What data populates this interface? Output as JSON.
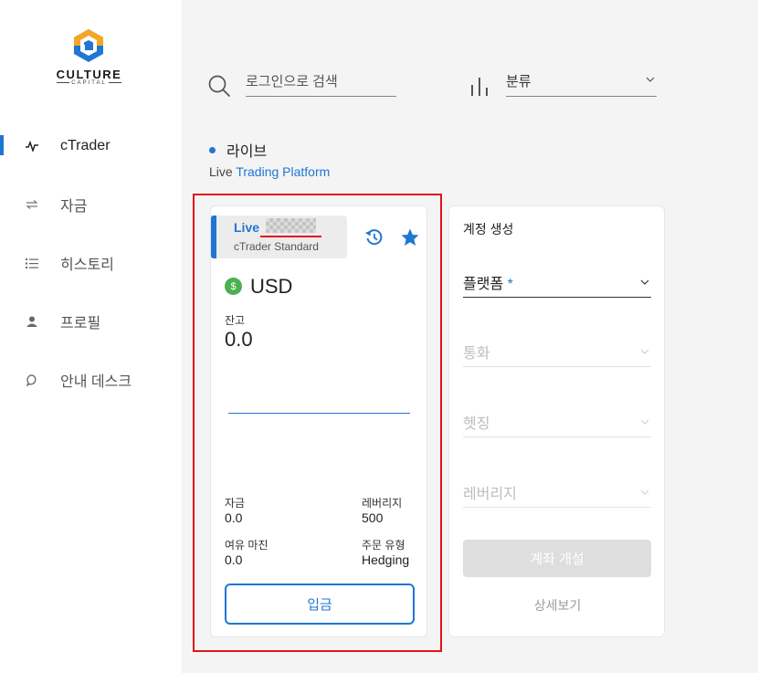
{
  "brand": {
    "name": "CULTURE",
    "sub": "CAPITAL",
    "colors": {
      "primary": "#1f76d3",
      "accent": "#f5a623"
    }
  },
  "sidebar": {
    "items": [
      {
        "label": "cTrader",
        "icon": "pulse-icon",
        "active": true
      },
      {
        "label": "자금",
        "icon": "transfer-icon"
      },
      {
        "label": "히스토리",
        "icon": "list-icon"
      },
      {
        "label": "프로필",
        "icon": "person-icon"
      },
      {
        "label": "안내 데스크",
        "icon": "chat-icon"
      }
    ]
  },
  "toolbar": {
    "search_placeholder": "로그인으로 검색",
    "category_label": "분류"
  },
  "section": {
    "title": "라이브",
    "subtitle_prefix": "Live",
    "subtitle_link": "Trading Platform"
  },
  "account_card": {
    "type": "Live",
    "platform": "cTrader Standard",
    "currency": "USD",
    "currency_symbol": "$",
    "balance_label": "잔고",
    "balance_value": "0.0",
    "funds_label": "자금",
    "funds_value": "0.0",
    "leverage_label": "레버리지",
    "leverage_value": "500",
    "free_margin_label": "여유 마진",
    "free_margin_value": "0.0",
    "order_type_label": "주문 유형",
    "order_type_value": "Hedging",
    "deposit_label": "입금"
  },
  "create_account": {
    "title": "계정 생성",
    "platform_label": "플랫폼",
    "required_mark": "*",
    "currency_label": "통화",
    "hedging_label": "헷징",
    "leverage_label": "레버리지",
    "open_button": "계좌 개설",
    "details_link": "상세보기"
  }
}
